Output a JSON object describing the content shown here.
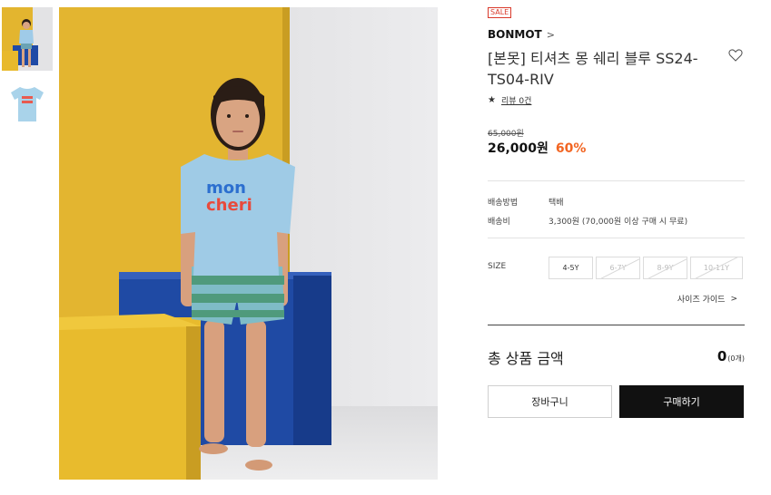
{
  "sale_badge": "SALE",
  "brand": {
    "name": "BONMOT",
    "chevron": ">"
  },
  "product": {
    "title": "[본못] 티셔츠 몽 쉐리 블루 SS24-TS04-RIV",
    "shirt_text_line1": "mon",
    "shirt_text_line2": "cheri"
  },
  "review": {
    "star": "★",
    "label": "리뷰 0건"
  },
  "pricing": {
    "original": "65,000원",
    "sale": "26,000원",
    "discount": "60%"
  },
  "shipping": [
    {
      "label": "배송방법",
      "value": "택배"
    },
    {
      "label": "배송비",
      "value": "3,300원 (70,000원 이상 구매 시 무료)"
    }
  ],
  "size": {
    "label": "SIZE",
    "options": [
      {
        "label": "4-5Y",
        "sold_out": false
      },
      {
        "label": "6-7Y",
        "sold_out": true
      },
      {
        "label": "8-9Y",
        "sold_out": true
      },
      {
        "label": "10-11Y",
        "sold_out": true
      }
    ],
    "guide": "사이즈 가이드",
    "guide_chevron": ">"
  },
  "total": {
    "label": "총 상품 금액",
    "amount": "0",
    "unit": "(0개)"
  },
  "buttons": {
    "cart": "장바구니",
    "buy": "구매하기"
  },
  "icons": {
    "wishlist": "heart-outline-icon",
    "chevron": "chevron-right-icon",
    "rating": "star-icon"
  },
  "colors": {
    "discount": "#f26522",
    "sale_badge": "#d93a2b",
    "buy_button": "#111111"
  }
}
